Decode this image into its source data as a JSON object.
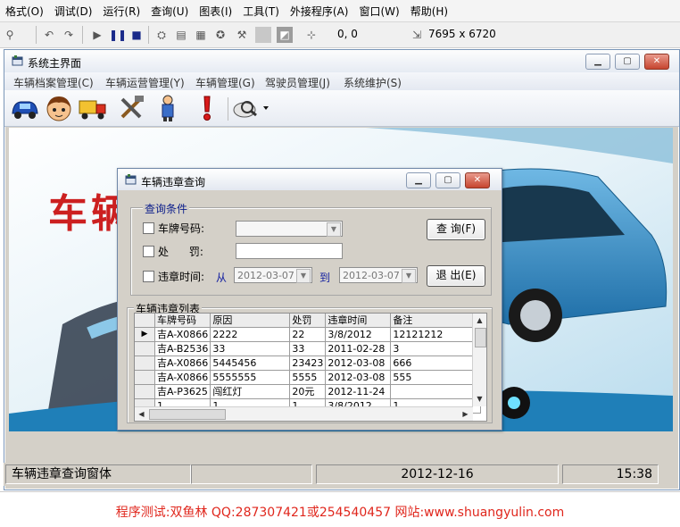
{
  "ide": {
    "menu": [
      "格式(O)",
      "调试(D)",
      "运行(R)",
      "查询(U)",
      "图表(I)",
      "工具(T)",
      "外接程序(A)",
      "窗口(W)",
      "帮助(H)"
    ],
    "coords": "0, 0",
    "size": "7695 x 6720"
  },
  "main_window": {
    "title": "系统主界面",
    "menu": [
      "车辆档案管理(C)",
      "车辆运营管理(Y)",
      "车辆管理(G)",
      "驾驶员管理(J)",
      "系统维护(S)"
    ],
    "logo_text": "车辆"
  },
  "dialog": {
    "title": "车辆违章查询",
    "group_query": "查询条件",
    "plate_label": "车牌号码:",
    "penalty_label": "处      罚:",
    "time_label": "违章时间:",
    "from_label": "从",
    "to_label": "到",
    "date_from": "2012-03-07",
    "date_to": "2012-03-07",
    "query_button": "查 询(F)",
    "exit_button": "退 出(E)",
    "group_list": "车辆违章列表",
    "columns": [
      "车牌号码",
      "原因",
      "处罚",
      "违章时间",
      "备注"
    ],
    "rows": [
      [
        "吉A-X0866",
        "2222",
        "22",
        "3/8/2012",
        "12121212"
      ],
      [
        "吉A-B2536",
        "33",
        "33",
        "2011-02-28",
        "3"
      ],
      [
        "吉A-X0866",
        "5445456",
        "23423",
        "2012-03-08",
        "666"
      ],
      [
        "吉A-X0866",
        "5555555",
        "5555",
        "2012-03-08",
        "555"
      ],
      [
        "吉A-P3625",
        "闯红灯",
        "20元",
        "2012-11-24",
        ""
      ],
      [
        "1",
        "1",
        "1",
        "3/8/2012",
        "1"
      ]
    ]
  },
  "status": {
    "left": "车辆违章查询窗体",
    "date": "2012-12-16",
    "time": "15:38"
  },
  "footer": "程序测试:双鱼林 QQ:287307421或254540457 网站:www.shuangyulin.com"
}
